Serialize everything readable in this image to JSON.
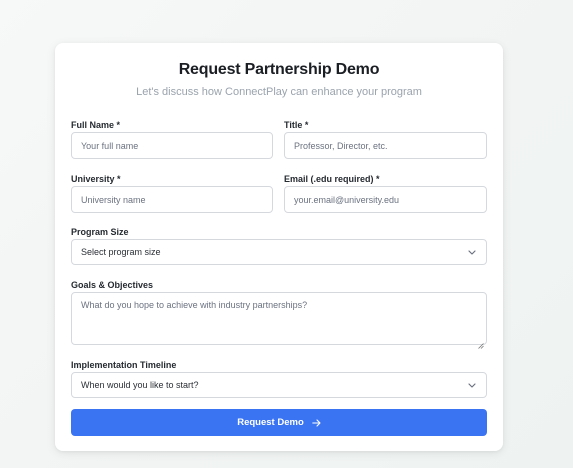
{
  "form": {
    "title": "Request Partnership Demo",
    "subtitle": "Let's discuss how ConnectPlay can enhance your program",
    "full_name": {
      "label": "Full Name *",
      "placeholder": "Your full name"
    },
    "job_title": {
      "label": "Title *",
      "placeholder": "Professor, Director, etc."
    },
    "university": {
      "label": "University *",
      "placeholder": "University name"
    },
    "email": {
      "label": "Email (.edu required) *",
      "placeholder": "your.email@university.edu"
    },
    "program_size": {
      "label": "Program Size",
      "selected": "Select program size"
    },
    "goals": {
      "label": "Goals & Objectives",
      "placeholder": "What do you hope to achieve with industry partnerships?"
    },
    "timeline": {
      "label": "Implementation Timeline",
      "selected": "When would you like to start?"
    },
    "submit_label": "Request Demo",
    "submit_icon": "arrow-right-icon",
    "select_icon": "chevron-down-icon",
    "accent_color": "#3b74f2"
  }
}
